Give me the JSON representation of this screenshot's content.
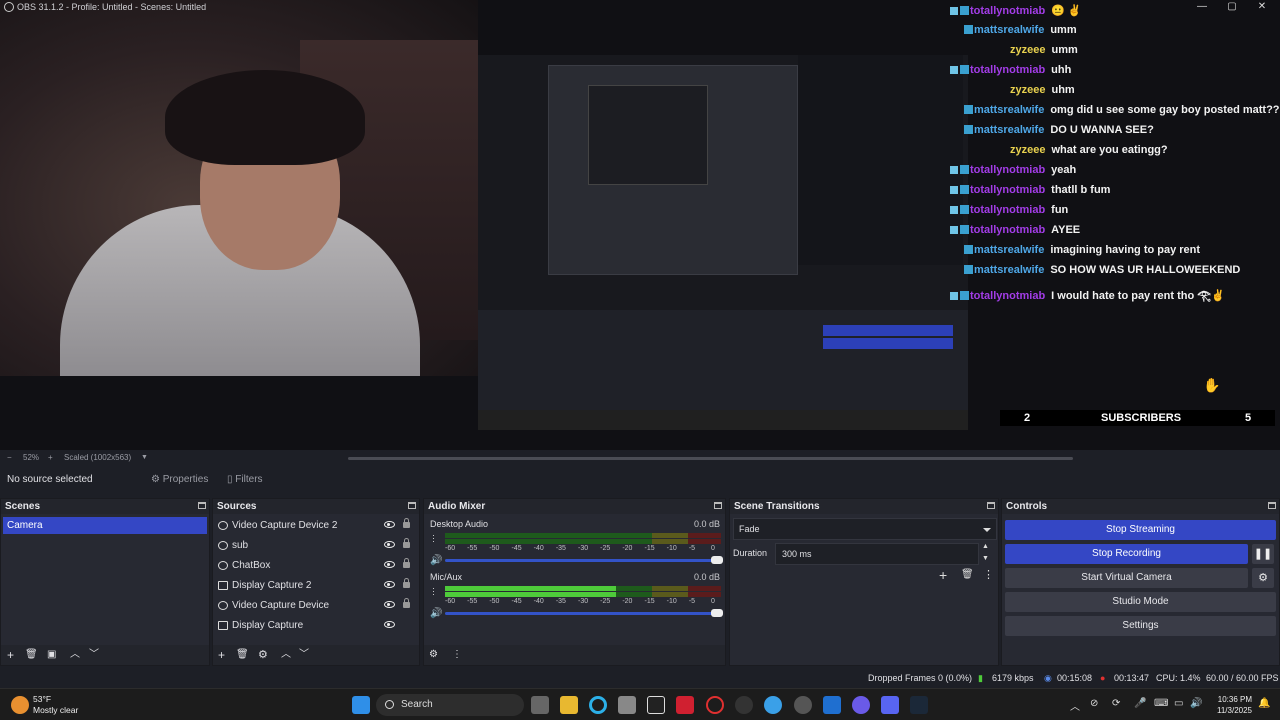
{
  "window": {
    "title": "OBS 31.1.2 - Profile: Untitled - Scenes: Untitled",
    "minimize": "—",
    "maximize": "▢",
    "close": "✕"
  },
  "chat": {
    "messages": [
      {
        "user": "totallynotmiab",
        "text": "😐 ✌",
        "color": "#a33de8"
      },
      {
        "user": "mattsrealwife",
        "text": "umm",
        "color": "#4fa8e8"
      },
      {
        "user": "zyzeee",
        "text": "umm",
        "color": "#e8d14f"
      },
      {
        "user": "totallynotmiab",
        "text": "uhh",
        "color": "#a33de8"
      },
      {
        "user": "zyzeee",
        "text": "uhm",
        "color": "#e8d14f"
      },
      {
        "user": "mattsrealwife",
        "text": "omg did u see some gay boy posted matt??",
        "color": "#4fa8e8"
      },
      {
        "user": "mattsrealwife",
        "text": "DO U WANNA SEE?",
        "color": "#4fa8e8"
      },
      {
        "user": "zyzeee",
        "text": "what are you eatingg?",
        "color": "#e8d14f"
      },
      {
        "user": "totallynotmiab",
        "text": "yeah",
        "color": "#a33de8"
      },
      {
        "user": "totallynotmiab",
        "text": "thatll b fum",
        "color": "#a33de8"
      },
      {
        "user": "totallynotmiab",
        "text": "fun",
        "color": "#a33de8"
      },
      {
        "user": "totallynotmiab",
        "text": "AYEE",
        "color": "#a33de8"
      },
      {
        "user": "mattsrealwife",
        "text": "imagining having to pay rent",
        "color": "#4fa8e8"
      },
      {
        "user": "mattsrealwife",
        "text": "SO HOW WAS UR HALLOWEEKEND",
        "color": "#4fa8e8"
      },
      {
        "user": "totallynotmiab",
        "text": "I would hate to pay rent tho 𓂀✌",
        "color": "#a33de8"
      }
    ]
  },
  "subs_bar": {
    "left_count": "2",
    "label": "SUBSCRIBERS",
    "right_count": "5"
  },
  "zoom": {
    "percent": "52%",
    "minus": "−",
    "plus": "+",
    "scaled": "Scaled (1002x563)"
  },
  "context": {
    "no_source": "No source selected",
    "properties": "Properties",
    "filters": "Filters"
  },
  "scenes": {
    "title": "Scenes",
    "items": [
      "Camera"
    ]
  },
  "sources": {
    "title": "Sources",
    "items": [
      "Video Capture Device 2",
      "sub",
      "ChatBox",
      "Display Capture 2",
      "Video Capture Device",
      "Display Capture"
    ]
  },
  "mixer": {
    "title": "Audio Mixer",
    "ticks": [
      "-60",
      "-55",
      "-50",
      "-45",
      "-40",
      "-35",
      "-30",
      "-25",
      "-20",
      "-15",
      "-10",
      "-5",
      "0"
    ],
    "channels": [
      {
        "name": "Desktop Audio",
        "db": "0.0 dB",
        "level": 0
      },
      {
        "name": "Mic/Aux",
        "db": "0.0 dB",
        "level": 0.62
      }
    ]
  },
  "transitions": {
    "title": "Scene Transitions",
    "selected": "Fade",
    "duration_label": "Duration",
    "duration_value": "300 ms"
  },
  "controls": {
    "title": "Controls",
    "stop_streaming": "Stop Streaming",
    "stop_recording": "Stop Recording",
    "virtual_camera": "Start Virtual Camera",
    "studio_mode": "Studio Mode",
    "settings": "Settings"
  },
  "status": {
    "dropped": "Dropped Frames 0 (0.0%)",
    "bitrate": "6179 kbps",
    "stream_time": "00:15:08",
    "rec_time": "00:13:47",
    "cpu": "CPU: 1.4%",
    "fps": "60.00 / 60.00 FPS"
  },
  "taskbar": {
    "temp": "53°F",
    "weather": "Mostly clear",
    "search": "Search",
    "time": "10:36 PM",
    "date": "11/3/2025"
  },
  "colors": {
    "accent": "#3447c5",
    "panel": "#272932",
    "background": "#1d1f26"
  }
}
